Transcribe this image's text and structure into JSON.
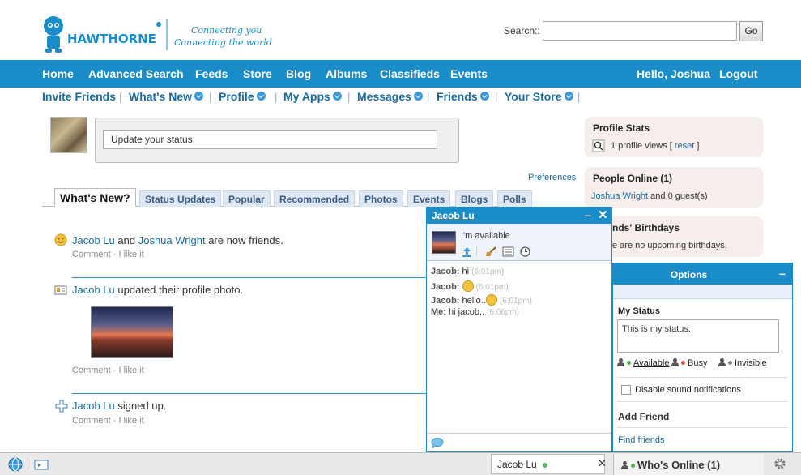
{
  "header": {
    "logo_text": "HAWTHORNE",
    "tagline_1": "Connecting you",
    "tagline_2": "Connecting the world",
    "search_label": "Search::",
    "search_value": "",
    "go_label": "Go"
  },
  "nav": {
    "items": [
      "Home",
      "Advanced Search",
      "Feeds",
      "Store",
      "Blog",
      "Albums",
      "Classifieds",
      "Events"
    ],
    "greeting": "Hello, Joshua",
    "logout": "Logout"
  },
  "subnav": {
    "items": [
      "Invite Friends",
      "What's New",
      "Profile",
      "My Apps",
      "Messages",
      "Friends",
      "Your Store"
    ]
  },
  "status": {
    "placeholder": "Update your status."
  },
  "preferences_label": "Preferences",
  "tabs": [
    "What's New?",
    "Status Updates",
    "Popular",
    "Recommended",
    "Photos",
    "Events",
    "Blogs",
    "Polls"
  ],
  "feed": [
    {
      "actor": "Jacob Lu",
      "mid": "and",
      "target": "Joshua Wright",
      "rest": "are now friends.",
      "actions": "Comment · I like it"
    },
    {
      "actor": "Jacob Lu",
      "rest": "updated their profile photo.",
      "actions": "Comment · I like it"
    },
    {
      "actor": "Jacob Lu",
      "rest": "signed up.",
      "actions": "Comment · I like it"
    }
  ],
  "sidebar": {
    "profile_stats_title": "Profile Stats",
    "profile_views": "1 profile views [",
    "reset": "reset",
    "close_bracket": "]",
    "people_online_title": "People Online (1)",
    "online_user": "Joshua Wright",
    "online_rest": "and 0 guest(s)",
    "birthdays_title": "nds' Birthdays",
    "birthdays_text": "e are no upcoming birthdays."
  },
  "chat": {
    "name": "Jacob Lu",
    "min": "–",
    "close": "✕",
    "status": "I'm available",
    "messages": [
      {
        "from": "Jacob:",
        "text": "hi",
        "time": "(6:01pm)"
      },
      {
        "from": "Jacob:",
        "text": "",
        "time": "(6:01pm)"
      },
      {
        "from": "Jacob:",
        "text": "hello..",
        "time": "(6:01pm)"
      },
      {
        "from": "Me:",
        "text": "hi jacob..",
        "time": "(6:06pm)"
      }
    ]
  },
  "options": {
    "title": "Options",
    "min": "–",
    "my_status_title": "My Status",
    "my_status_value": "This is my status..",
    "available": "Available",
    "busy": "Busy",
    "invisible": "Invisible",
    "sound_label": "Disable sound notifications",
    "add_friend_title": "Add Friend",
    "find_friends": "Find friends"
  },
  "bottombar": {
    "chat_name": "Jacob Lu",
    "chat_close": "✕",
    "whos_online": "Who's Online (1)"
  },
  "colors": {
    "brand_blue": "#1a8cc7",
    "link": "#1b6a9c",
    "sidebar_bg": "#f6eeea"
  }
}
